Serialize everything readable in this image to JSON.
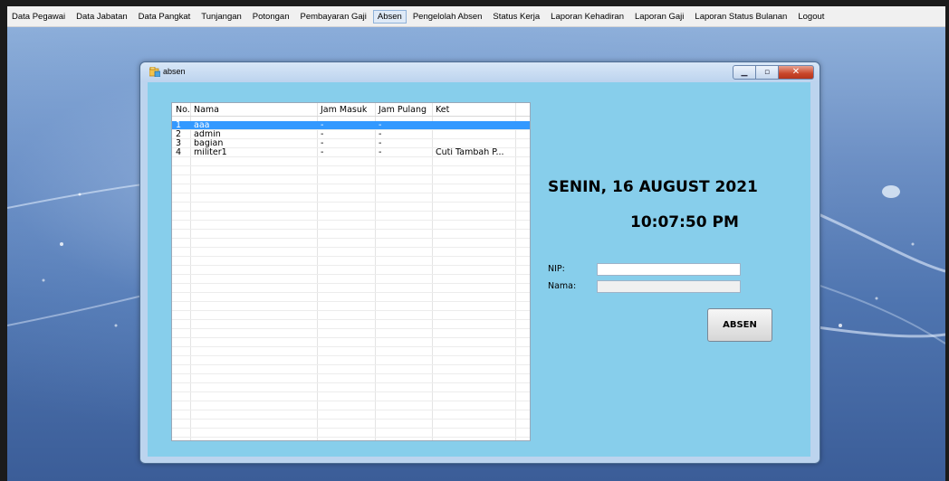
{
  "menubar": {
    "items": [
      {
        "label": "Data Pegawai"
      },
      {
        "label": "Data Jabatan"
      },
      {
        "label": "Data Pangkat"
      },
      {
        "label": "Tunjangan"
      },
      {
        "label": "Potongan"
      },
      {
        "label": "Pembayaran Gaji"
      },
      {
        "label": "Absen",
        "active": true
      },
      {
        "label": "Pengelolah Absen"
      },
      {
        "label": "Status Kerja"
      },
      {
        "label": "Laporan Kehadiran"
      },
      {
        "label": "Laporan Gaji"
      },
      {
        "label": "Laporan Status Bulanan"
      },
      {
        "label": "Logout"
      }
    ]
  },
  "window": {
    "title": "absen",
    "minimize_icon": "minimize-icon",
    "maximize_icon": "maximize-icon",
    "close_icon": "close-icon"
  },
  "table": {
    "columns": [
      "No.",
      "Nama",
      "Jam Masuk",
      "Jam Pulang",
      "Ket"
    ],
    "rows": [
      {
        "no": "1",
        "nama": "aaa",
        "jam_masuk": "-",
        "jam_pulang": "-",
        "ket": ""
      },
      {
        "no": "2",
        "nama": "admin",
        "jam_masuk": "-",
        "jam_pulang": "-",
        "ket": ""
      },
      {
        "no": "3",
        "nama": "bagian",
        "jam_masuk": "-",
        "jam_pulang": "-",
        "ket": ""
      },
      {
        "no": "4",
        "nama": "militer1",
        "jam_masuk": "-",
        "jam_pulang": "-",
        "ket": "Cuti Tambah P..."
      }
    ],
    "selected_row": 0
  },
  "clock": {
    "date": "SENIN, 16 AUGUST 2021",
    "time": "10:07:50 PM"
  },
  "form": {
    "nip_label": "NIP:",
    "nip_value": "",
    "nama_label": "Nama:",
    "nama_value": "",
    "submit_label": "ABSEN"
  },
  "colors": {
    "client_bg": "#87ceeb",
    "selection": "#3399ff"
  }
}
